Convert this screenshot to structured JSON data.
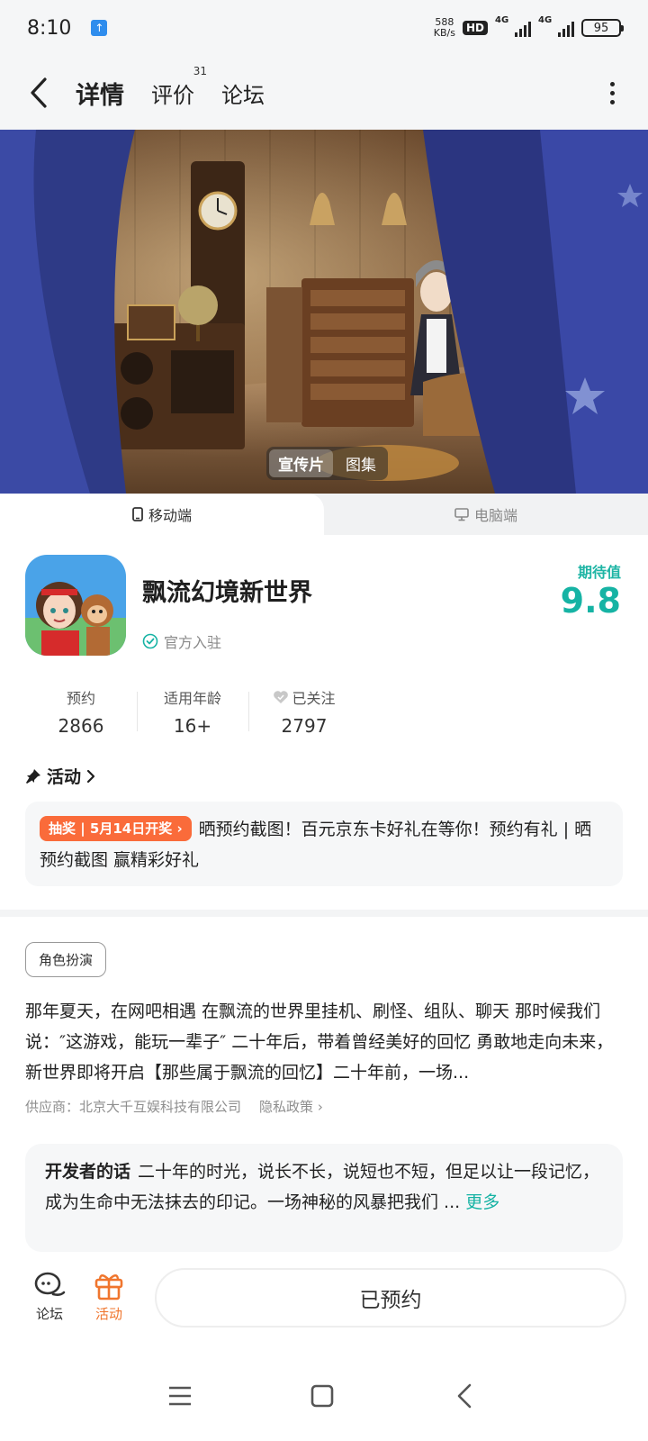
{
  "status_bar": {
    "time": "8:10",
    "net_speed_value": "588",
    "net_speed_unit": "KB/s",
    "hd_badge": "HD",
    "signal1_label": "4G",
    "signal2_label": "4G",
    "battery": "95"
  },
  "header": {
    "tabs": [
      {
        "label": "详情",
        "active": true
      },
      {
        "label": "评价",
        "badge": "31"
      },
      {
        "label": "论坛"
      }
    ]
  },
  "hero": {
    "media_tabs": [
      "宣传片",
      "图集"
    ]
  },
  "platform_tabs": {
    "mobile": "移动端",
    "pc": "电脑端"
  },
  "app": {
    "name": "飘流幻境新世界",
    "official_label": "官方入驻",
    "expect_label": "期待值",
    "expect_value": "9.8"
  },
  "stats": [
    {
      "label": "预约",
      "value": "2866"
    },
    {
      "label": "适用年龄",
      "value": "16+"
    },
    {
      "label": "已关注",
      "value": "2797"
    }
  ],
  "activity": {
    "title": "活动",
    "badge": "抽奖 | 5月14日开奖",
    "text": "晒预约截图！百元京东卡好礼在等你！预约有礼 | 晒预约截图 赢精彩好礼"
  },
  "detail": {
    "genre_tag": "角色扮演",
    "description": "那年夏天，在网吧相遇 在飘流的世界里挂机、刷怪、组队、聊天 那时候我们说：″这游戏，能玩一辈子″ 二十年后，带着曾经美好的回忆 勇敢地走向未来，新世界即将开启【那些属于飘流的回忆】二十年前，一场...",
    "supplier": "供应商：北京大千互娱科技有限公司",
    "privacy": "隐私政策"
  },
  "developer": {
    "title": "开发者的话",
    "text": "二十年的时光，说长不长，说短也不短，但足以让一段记忆，成为生命中无法抹去的印记。一场神秘的风暴把我们 ...",
    "more": "更多"
  },
  "bottom_bar": {
    "forum": "论坛",
    "activity": "活动",
    "reserve": "已预约"
  },
  "colors": {
    "accent": "#16b3a4",
    "promo": "#fa6b3a",
    "activity": "#f0762e"
  }
}
